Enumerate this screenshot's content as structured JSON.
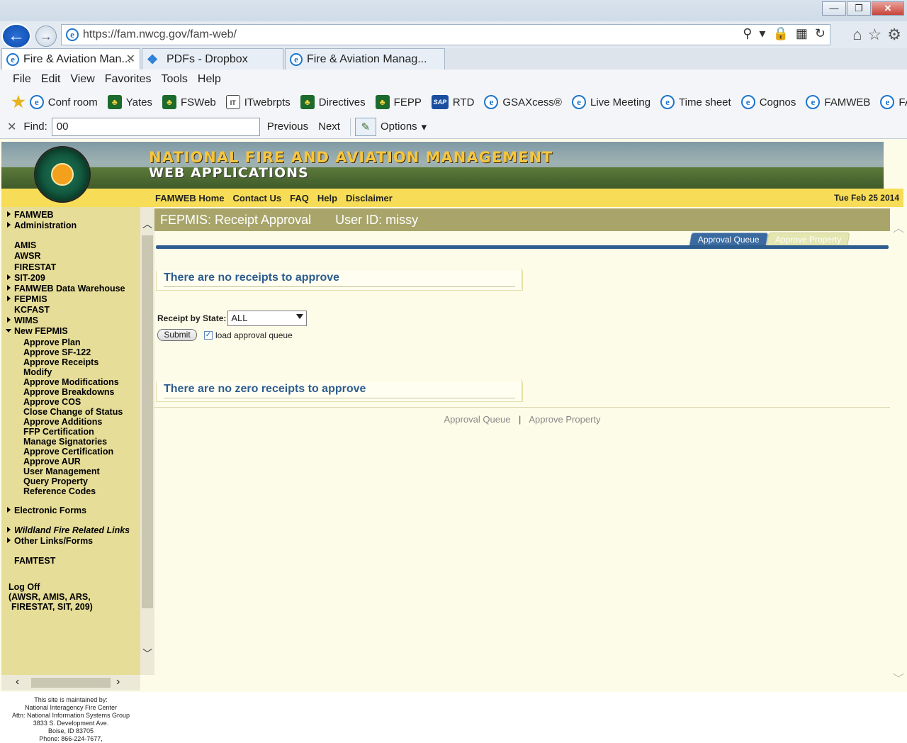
{
  "browser": {
    "address": "https://fam.nwcg.gov/fam-web/",
    "tabs": [
      "Fire & Aviation Man...",
      "PDFs - Dropbox",
      "Fire & Aviation Manag..."
    ],
    "menu": [
      "File",
      "Edit",
      "View",
      "Favorites",
      "Tools",
      "Help"
    ],
    "favorites": [
      "Conf room",
      "Yates",
      "FSWeb",
      "ITwebrpts",
      "Directives",
      "FEPP",
      "RTD",
      "GSAXcess®",
      "Live Meeting",
      "Time sheet",
      "Cognos",
      "FAMWEB",
      "FAMTEST"
    ],
    "find": {
      "label": "Find:",
      "value": "00",
      "previous": "Previous",
      "next": "Next",
      "options": "Options"
    }
  },
  "banner": {
    "title_line1": "NATIONAL FIRE AND AVIATION MANAGEMENT",
    "title_line2": "WEB APPLICATIONS"
  },
  "nav": {
    "links": [
      "FAMWEB Home",
      "Contact Us",
      "FAQ",
      "Help",
      "Disclaimer"
    ],
    "date": "Tue Feb 25 2014"
  },
  "sidebar": {
    "items": [
      "FAMWEB",
      "Administration",
      "AMIS",
      "AWSR",
      "FIRESTAT",
      "SIT-209",
      "FAMWEB Data Warehouse",
      "FEPMIS",
      "KCFAST",
      "WIMS",
      "New FEPMIS"
    ],
    "sub": [
      "Approve Plan",
      "Approve SF-122",
      "Approve Receipts",
      "Modify",
      "Approve Modifications",
      "Approve Breakdowns",
      "Approve COS",
      "Close Change of Status",
      "Approve Additions",
      "FFP Certification",
      "Manage Signatories",
      "Approve Certification",
      "Approve AUR",
      "User Management",
      "Query Property",
      "Reference Codes"
    ],
    "lower": [
      "Electronic Forms",
      "Wildland Fire Related Links",
      "Other Links/Forms",
      "FAMTEST"
    ],
    "logoff1": "Log Off",
    "logoff2": "(AWSR, AMIS, ARS,",
    "logoff3": "FIRESTAT, SIT, 209)",
    "footer": [
      "This site is maintained by:",
      "National Interagency Fire Center",
      "Attn: National Information Systems Group",
      "3833 S. Development Ave.",
      "Boise, ID 83705",
      "Phone: 866-224-7677,"
    ]
  },
  "main": {
    "title": "FEPMIS: Receipt Approval",
    "user": "User ID: missy",
    "tab_active": "Approval Queue",
    "tab_inactive": "Approve Property",
    "msg1": "There are no receipts to approve",
    "msg2": "There are no zero receipts to approve",
    "state_label": "Receipt by State:",
    "state_value": "ALL",
    "submit": "Submit",
    "checkbox_label": "load approval queue",
    "bottom_link1": "Approval Queue",
    "bottom_link2": "Approve Property",
    "bottom_sep": "|"
  }
}
